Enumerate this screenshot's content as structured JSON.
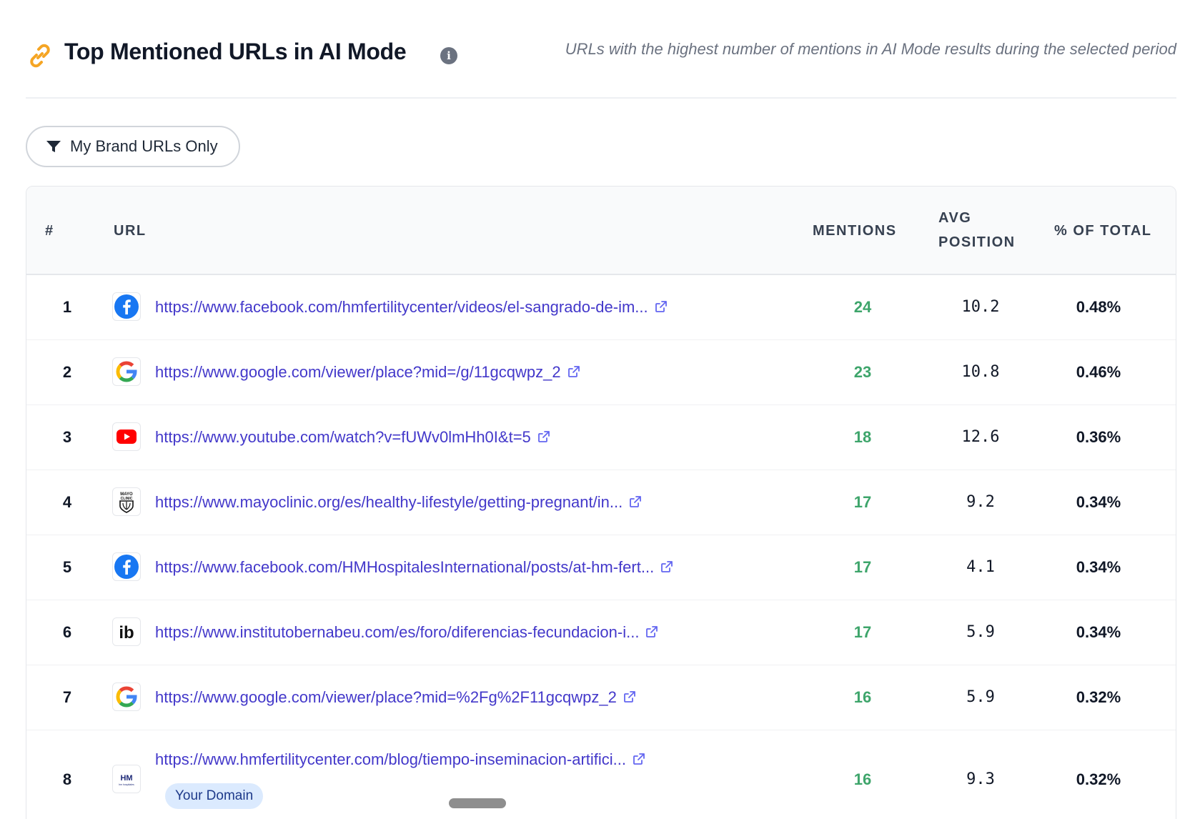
{
  "header": {
    "icon": "link-icon",
    "title": "Top Mentioned URLs in AI Mode",
    "info_icon": "info-icon",
    "info_glyph": "i",
    "subtitle": "URLs with the highest number of mentions in AI Mode results during the selected period"
  },
  "filter": {
    "icon": "funnel-icon",
    "label": "My Brand URLs Only"
  },
  "table": {
    "columns": {
      "num": "#",
      "url": "URL",
      "mentions": "MENTIONS",
      "avg_position": "AVG POSITION",
      "pct_total": "% OF TOTAL"
    },
    "rows": [
      {
        "num": "1",
        "favicon": "facebook-icon",
        "url": "https://www.facebook.com/hmfertilitycenter/videos/el-sangrado-de-im...",
        "mentions": "24",
        "avg_position": "10.2",
        "pct_total": "0.48%"
      },
      {
        "num": "2",
        "favicon": "google-icon",
        "url": "https://www.google.com/viewer/place?mid=/g/11gcqwpz_2",
        "mentions": "23",
        "avg_position": "10.8",
        "pct_total": "0.46%"
      },
      {
        "num": "3",
        "favicon": "youtube-icon",
        "url": "https://www.youtube.com/watch?v=fUWv0lmHh0I&t=5",
        "mentions": "18",
        "avg_position": "12.6",
        "pct_total": "0.36%"
      },
      {
        "num": "4",
        "favicon": "mayo-clinic-icon",
        "url": "https://www.mayoclinic.org/es/healthy-lifestyle/getting-pregnant/in...",
        "mentions": "17",
        "avg_position": "9.2",
        "pct_total": "0.34%"
      },
      {
        "num": "5",
        "favicon": "facebook-icon",
        "url": "https://www.facebook.com/HMHospitalesInternational/posts/at-hm-fert...",
        "mentions": "17",
        "avg_position": "4.1",
        "pct_total": "0.34%"
      },
      {
        "num": "6",
        "favicon": "instituto-bernabeu-icon",
        "url": "https://www.institutobernabeu.com/es/foro/diferencias-fecundacion-i...",
        "mentions": "17",
        "avg_position": "5.9",
        "pct_total": "0.34%"
      },
      {
        "num": "7",
        "favicon": "google-icon",
        "url": "https://www.google.com/viewer/place?mid=%2Fg%2F11gcqwpz_2",
        "mentions": "16",
        "avg_position": "5.9",
        "pct_total": "0.32%"
      },
      {
        "num": "8",
        "favicon": "hm-hospitales-icon",
        "url": "https://www.hmfertilitycenter.com/blog/tiempo-inseminacion-artifici...",
        "mentions": "16",
        "avg_position": "9.3",
        "pct_total": "0.32%",
        "badge": "Your Domain"
      }
    ]
  },
  "favicon_text": {
    "mayo": "MAYO CLINIC",
    "ib": "ib",
    "hm": "HM",
    "hm_sub": "hm hospitales"
  },
  "colors": {
    "title": "#111827",
    "link": "#4338ca",
    "mentions": "#3ea56b",
    "badge_bg": "#dbeafe",
    "badge_text": "#1e3a8a",
    "link_icon": "#f5a524"
  }
}
